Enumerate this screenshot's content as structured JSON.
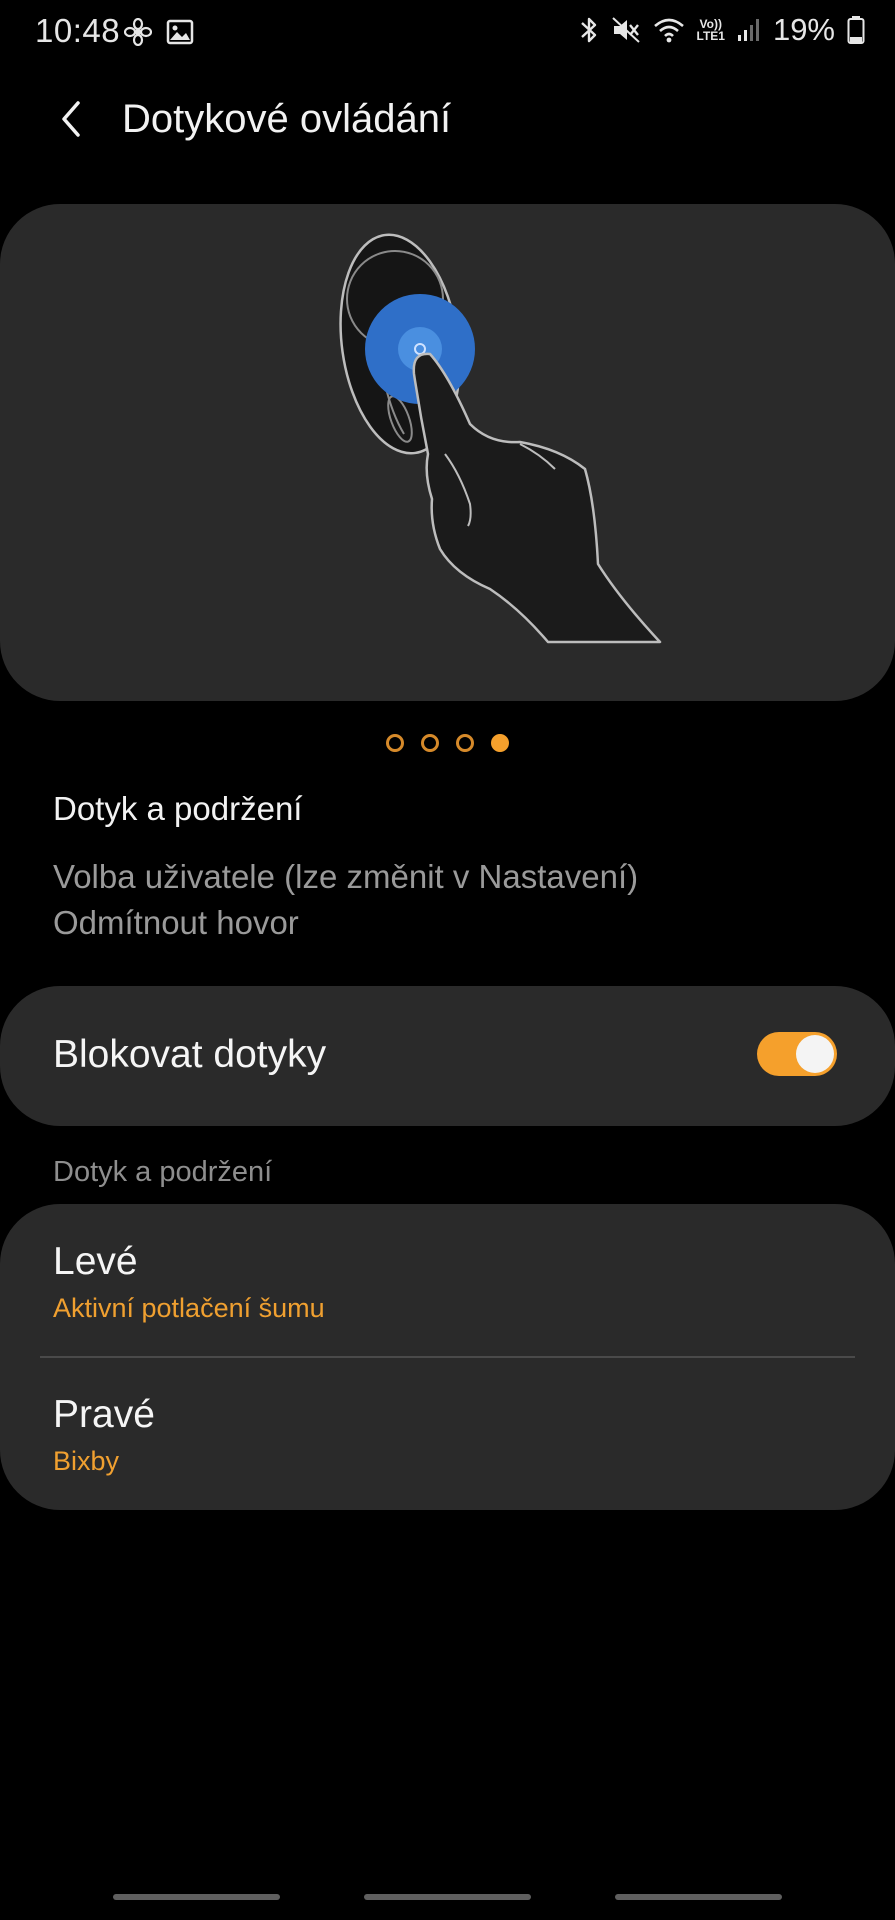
{
  "status_bar": {
    "time": "10:48",
    "battery_percent": "19%",
    "lte_top": "Vo))",
    "lte_bottom": "LTE1",
    "left_icons": [
      "fan-icon",
      "image-icon"
    ],
    "right_icons": [
      "bluetooth-icon",
      "mute-icon",
      "wifi-icon",
      "signal-icon",
      "battery-icon"
    ]
  },
  "header": {
    "title": "Dotykové ovládání"
  },
  "carousel": {
    "page_count": 4,
    "active_page": 4,
    "colors": {
      "accent": "#f5a02c",
      "touch_blue": "#2f6fc8"
    }
  },
  "description": {
    "title": "Dotyk a podržení",
    "line1": "Volba uživatele (lze změnit v Nastavení)",
    "line2": "Odmítnout hovor"
  },
  "block_touches": {
    "label": "Blokovat dotyky",
    "enabled": true
  },
  "section": {
    "label": "Dotyk a podržení"
  },
  "sides": [
    {
      "title": "Levé",
      "value": "Aktivní potlačení šumu"
    },
    {
      "title": "Pravé",
      "value": "Bixby"
    }
  ],
  "colors": {
    "background": "#000000",
    "card": "#2a2a2a",
    "accent": "#f5a02c",
    "text_secondary": "#9a9a9a"
  }
}
